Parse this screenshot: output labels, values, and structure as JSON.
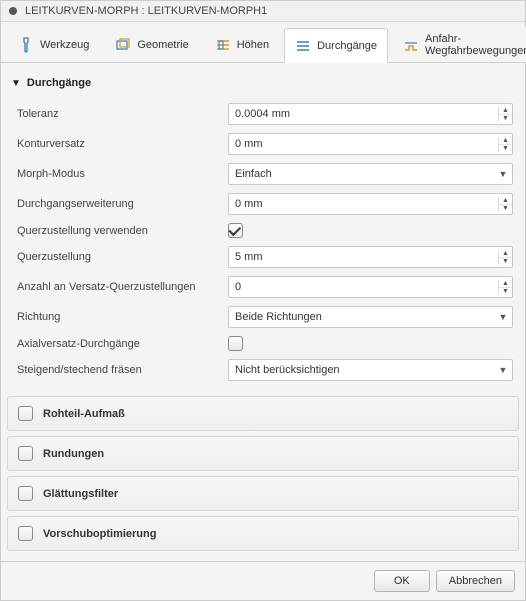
{
  "title": "LEITKURVEN-MORPH : LEITKURVEN-MORPH1",
  "tabs": {
    "tool": "Werkzeug",
    "geometry": "Geometrie",
    "heights": "Höhen",
    "passes": "Durchgänge",
    "moves": "Anfahr-Wegfahrbewegungen"
  },
  "section": {
    "passes": "Durchgänge"
  },
  "fields": {
    "tolerance": {
      "label": "Toleranz",
      "value": "0.0004 mm"
    },
    "contourOffset": {
      "label": "Konturversatz",
      "value": "0 mm"
    },
    "morphMode": {
      "label": "Morph-Modus",
      "value": "Einfach"
    },
    "passExtension": {
      "label": "Durchgangserweiterung",
      "value": "0 mm"
    },
    "useStepover": {
      "label": "Querzustellung verwenden",
      "checked": true
    },
    "stepover": {
      "label": "Querzustellung",
      "value": "5 mm"
    },
    "offsetStepovers": {
      "label": "Anzahl an Versatz-Querzustellungen",
      "value": "0"
    },
    "direction": {
      "label": "Richtung",
      "value": "Beide Richtungen"
    },
    "axialOffsetPasses": {
      "label": "Axialversatz-Durchgänge",
      "checked": false
    },
    "climbConv": {
      "label": "Steigend/stechend fräsen",
      "value": "Nicht berücksichtigen"
    }
  },
  "groups": {
    "stock": "Rohteil-Aufmaß",
    "fillets": "Rundungen",
    "smoothing": "Glättungsfilter",
    "feedOpt": "Vorschuboptimierung"
  },
  "buttons": {
    "ok": "OK",
    "cancel": "Abbrechen"
  }
}
